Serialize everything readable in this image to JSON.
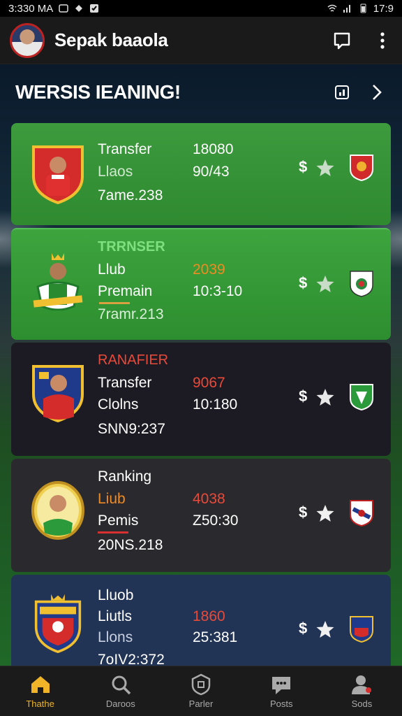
{
  "status": {
    "time": "3:330 MA",
    "right_time": "17:9"
  },
  "appbar": {
    "title": "Sepak baaola"
  },
  "section": {
    "title": "WERSIS IEANING!"
  },
  "rows": [
    {
      "label1": "Transfer",
      "label2": "Llaos",
      "label3": "7ame.238",
      "num1": "18080",
      "num2": "90/43",
      "dollar": "$"
    },
    {
      "label0": "TRRNSER",
      "label1": "Llub",
      "label2": "Premain",
      "label3": "7ramr.213",
      "num1": "2039",
      "num2": "10:3-10",
      "dollar": "$"
    },
    {
      "label0": "RANAFIER",
      "label1": "Transfer",
      "label2": "Clolns",
      "label3": "SNN9:237",
      "num1": "9067",
      "num2": "10:180",
      "dollar": "$"
    },
    {
      "label1": "Ranking",
      "label2": "Liub",
      "label3": "Pemis",
      "label4": "20NS.218",
      "num1": "4038",
      "num2": "Z50:30",
      "dollar": "$"
    },
    {
      "label1": "Lluob",
      "label2": "Liutls",
      "label3": "Llons",
      "label4": "7oIV2:372",
      "num1": "1860",
      "num2": "25:381",
      "dollar": "$"
    }
  ],
  "nav": [
    {
      "label": "Thathe",
      "icon": "home-icon"
    },
    {
      "label": "Daroos",
      "icon": "search-icon"
    },
    {
      "label": "Parler",
      "icon": "shield-icon"
    },
    {
      "label": "Posts",
      "icon": "chat-icon"
    },
    {
      "label": "Sods",
      "icon": "profile-icon"
    }
  ],
  "colors": {
    "accent": "#f0b429",
    "green_card": "#3d9a3d",
    "dark_card": "#1c1a22",
    "navy_card": "#223456"
  }
}
